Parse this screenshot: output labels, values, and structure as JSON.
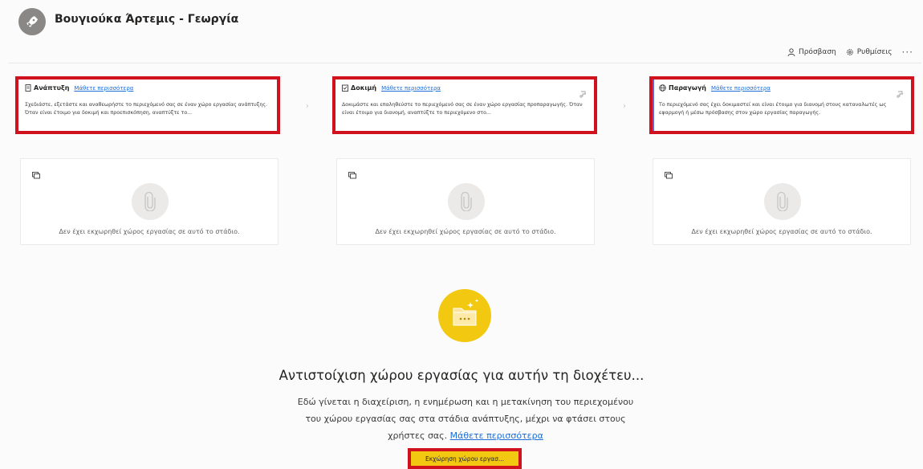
{
  "header": {
    "title": "Βουγιούκα Άρτεμις - Γεωργία",
    "access_label": "Πρόσβαση",
    "settings_label": "Ρυθμίσεις",
    "more_label": "···"
  },
  "stages": [
    {
      "name": "Ανάπτυξη",
      "link": "Μάθετε περισσότερα",
      "description": "Σχεδιάστε, εξετάστε και αναθεωρήστε το περιεχόμενό σας σε έναν χώρο εργασίας ανάπτυξης. Όταν είναι έτοιμο για δοκιμή και προεπισκόπηση, αναπτύξτε το..."
    },
    {
      "name": "Δοκιμή",
      "link": "Μάθετε περισσότερα",
      "description": "Δοκιμάστε και επαληθεύστε το περιεχόμενό σας σε έναν χώρο εργασίας προπαραγωγής. Όταν είναι έτοιμο για διανομή, αναπτύξτε το περιεχόμενο στο..."
    },
    {
      "name": "Παραγωγή",
      "link": "Μάθετε περισσότερα",
      "description": "Το περιεχόμενό σας έχει δοκιμαστεί και είναι έτοιμο για διανομή στους καταναλωτές ως εφαρμογή ή μέσω πρόσβασης στον χώρο εργασίας παραγωγής."
    }
  ],
  "workspace_empty": "Δεν έχει εκχωρηθεί χώρος εργασίας σε αυτό το στάδιο.",
  "main": {
    "title": "Αντιστοίχιση χώρου εργασίας για αυτήν τη διοχέτευ...",
    "line1": "Εδώ γίνεται η διαχείριση, η ενημέρωση και η μετακίνηση του περιεχομένου",
    "line2": "του χώρου εργασίας σας στα στάδια ανάπτυξης, μέχρι να φτάσει στους",
    "line3": "χρήστες σας.",
    "link": "Μάθετε περισσότερα",
    "button": "Εκχώρηση χώρου εργασ..."
  },
  "colors": {
    "highlight": "#d0121e",
    "accent_yellow": "#f2c811",
    "link": "#1c6ed6"
  }
}
